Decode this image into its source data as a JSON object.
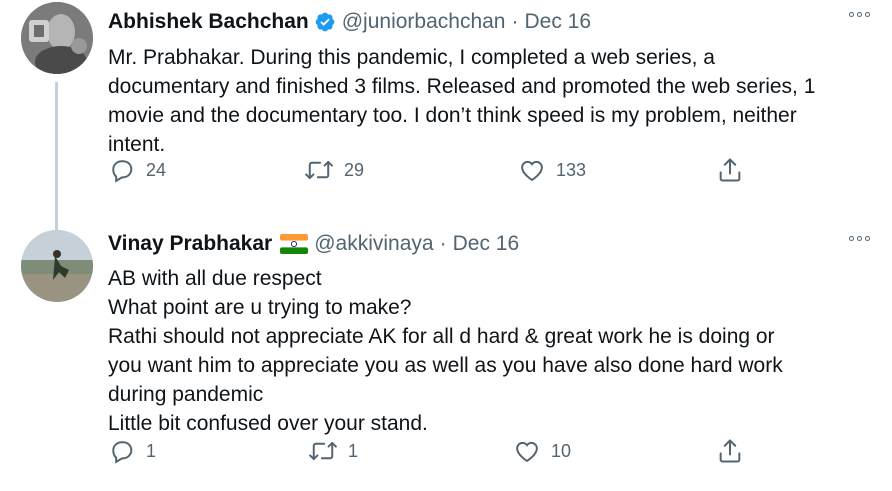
{
  "tweets": [
    {
      "name": "Abhishek Bachchan",
      "handle": "@juniorbachchan",
      "separator": "·",
      "date": "Dec 16",
      "lines": [
        "Mr. Prabhakar. During this pandemic, I completed a web series, a",
        "documentary and finished 3 films. Released and promoted the web series, 1",
        "movie and the documentary too. I don’t think speed is my problem, neither",
        "intent."
      ],
      "reply_count": "24",
      "retweet_count": "29",
      "like_count": "133",
      "badge_icon": "verified-badge-icon"
    },
    {
      "name": "Vinay Prabhakar",
      "handle": "@akkivinaya",
      "separator": "·",
      "date": "Dec 16",
      "lines": [
        "AB with all due respect",
        "What point are u trying to make?",
        "Rathi should not appreciate AK for all d hard & great work he is doing or",
        "you want him to appreciate you as well as you have also done hard work",
        "during pandemic",
        "Little bit confused over your stand."
      ],
      "reply_count": "1",
      "retweet_count": "1",
      "like_count": "10",
      "badge_icon": "india-flag-icon"
    }
  ],
  "colors": {
    "text": "#0f1419",
    "secondary": "#536471",
    "verified": "#1d9bf0",
    "thread_line": "#c4cfd6"
  }
}
